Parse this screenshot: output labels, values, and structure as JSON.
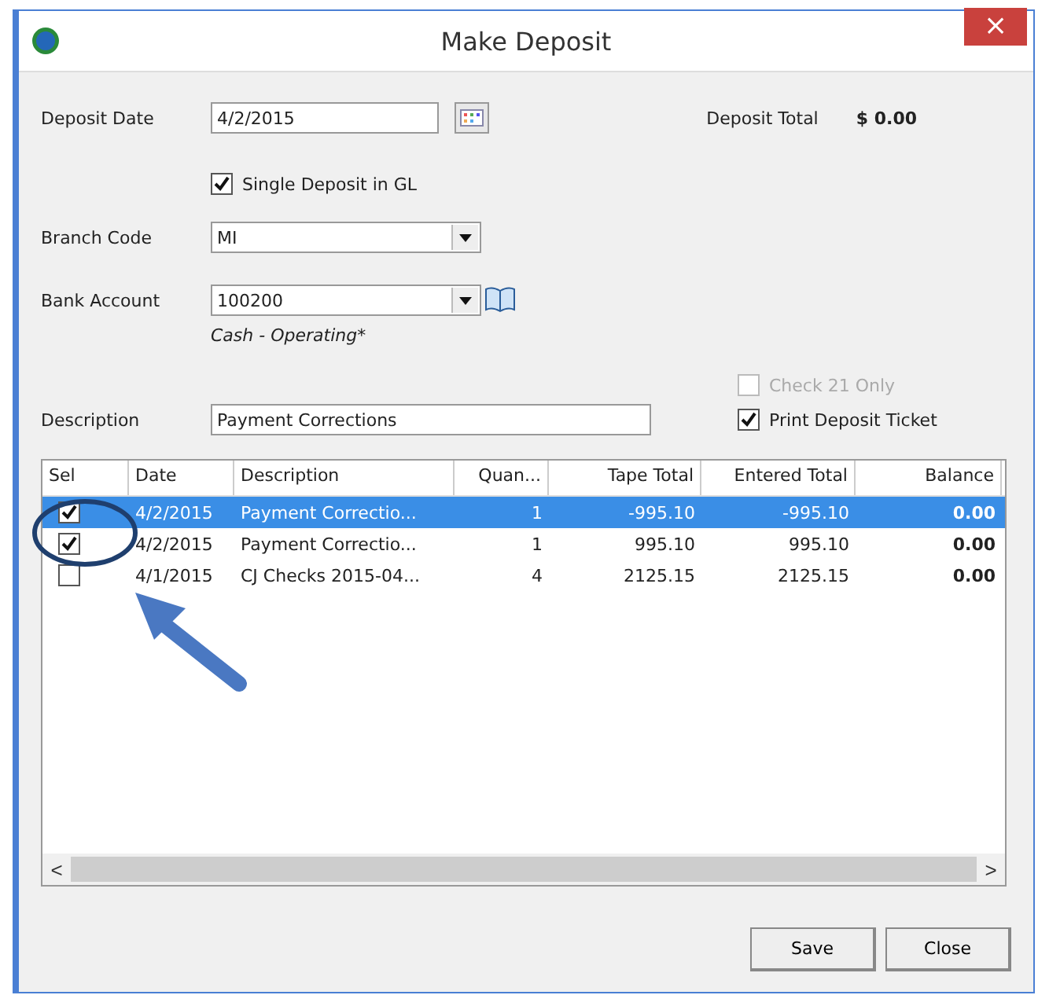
{
  "window": {
    "title": "Make Deposit",
    "close": "×"
  },
  "deposit_date": {
    "label": "Deposit Date",
    "value": "4/2/2015"
  },
  "deposit_total": {
    "label": "Deposit Total",
    "value": "$ 0.00"
  },
  "single_deposit": {
    "label": "Single Deposit in GL",
    "checked": true
  },
  "branch_code": {
    "label": "Branch Code",
    "value": "MI"
  },
  "bank_account": {
    "label": "Bank Account",
    "value": "100200",
    "account_name": "Cash - Operating*"
  },
  "check21": {
    "label": "Check 21 Only",
    "checked": false,
    "disabled": true
  },
  "description": {
    "label": "Description",
    "value": "Payment Corrections"
  },
  "print_ticket": {
    "label": "Print Deposit Ticket",
    "checked": true,
    "disabled": false
  },
  "table": {
    "checkbox_column": "Sel",
    "columns": [
      "Date",
      "Description",
      "Quan...",
      "Tape Total",
      "Entered Total",
      "Balance"
    ],
    "rows": [
      {
        "selected": true,
        "checked": true,
        "cells": [
          "4/2/2015",
          "Payment Correctio...",
          "1",
          "-995.10",
          "-995.10",
          "0.00"
        ]
      },
      {
        "selected": false,
        "checked": true,
        "cells": [
          "4/2/2015",
          "Payment Correctio...",
          "1",
          "995.10",
          "995.10",
          "0.00"
        ]
      },
      {
        "selected": false,
        "checked": false,
        "cells": [
          "4/1/2015",
          "CJ Checks 2015-04...",
          "4",
          "2125.15",
          "2125.15",
          "0.00"
        ]
      }
    ]
  },
  "scrollbar": {
    "left": "<",
    "right": ">"
  },
  "buttons": [
    "Save",
    "Close"
  ]
}
